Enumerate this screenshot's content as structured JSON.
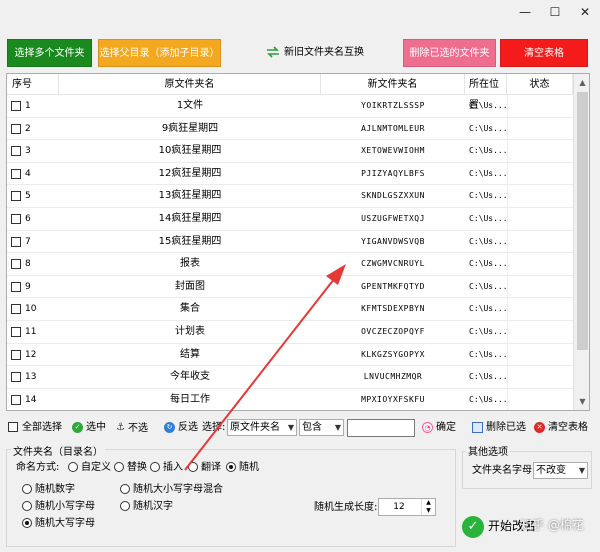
{
  "window": {
    "min": "—",
    "max": "☐",
    "close": "✕"
  },
  "toolbar": {
    "select_multi": "选择多个文件夹",
    "select_parent": "选择父目录（添加子目录）",
    "swap": "新旧文件夹名互换",
    "delete_selected": "删除已选的文件夹",
    "clear_table": "清空表格"
  },
  "colors": {
    "green": "#1a8a1e",
    "orange": "#f4a81f",
    "pink": "#ef6e8f",
    "red": "#f41b1b",
    "arrow": "#e53935"
  },
  "table": {
    "headers": [
      "序号",
      "原文件夹名",
      "新文件夹名",
      "所在位置",
      "状态"
    ],
    "rows": [
      {
        "idx": "1",
        "orig": "1文件",
        "new": "YOIKRTZLSSSP",
        "loc": "C:\\Us...",
        "status": ""
      },
      {
        "idx": "2",
        "orig": "9疯狂星期四",
        "new": "AJLNMTOMLEUR",
        "loc": "C:\\Us...",
        "status": ""
      },
      {
        "idx": "3",
        "orig": "10疯狂星期四",
        "new": "XETOWEVWIOHM",
        "loc": "C:\\Us...",
        "status": ""
      },
      {
        "idx": "4",
        "orig": "12疯狂星期四",
        "new": "PJIZYAQYLBFS",
        "loc": "C:\\Us...",
        "status": ""
      },
      {
        "idx": "5",
        "orig": "13疯狂星期四",
        "new": "SKNDLGSZXXUN",
        "loc": "C:\\Us...",
        "status": ""
      },
      {
        "idx": "6",
        "orig": "14疯狂星期四",
        "new": "USZUGFWETXQJ",
        "loc": "C:\\Us...",
        "status": ""
      },
      {
        "idx": "7",
        "orig": "15疯狂星期四",
        "new": "YIGANVDWSVQB",
        "loc": "C:\\Us...",
        "status": ""
      },
      {
        "idx": "8",
        "orig": "报表",
        "new": "CZWGMVCNRUYL",
        "loc": "C:\\Us...",
        "status": ""
      },
      {
        "idx": "9",
        "orig": "封面图",
        "new": "GPENTMKFQTYD",
        "loc": "C:\\Us...",
        "status": ""
      },
      {
        "idx": "10",
        "orig": "集合",
        "new": "KFMTSDEXPBYN",
        "loc": "C:\\Us...",
        "status": ""
      },
      {
        "idx": "11",
        "orig": "计划表",
        "new": "OVCZECZOPQYF",
        "loc": "C:\\Us...",
        "status": ""
      },
      {
        "idx": "12",
        "orig": "结算",
        "new": "KLKGZSYGOPYX",
        "loc": "C:\\Us...",
        "status": ""
      },
      {
        "idx": "13",
        "orig": "今年收支",
        "new": "LNVUCMHZMQR",
        "loc": "C:\\Us...",
        "status": ""
      },
      {
        "idx": "14",
        "orig": "每日工作",
        "new": "MPXIOYXFSKFU",
        "loc": "C:\\Us...",
        "status": ""
      }
    ]
  },
  "selection": {
    "select_all": "全部选择",
    "check": "选中",
    "uncheck": "不选",
    "invert": "反选",
    "select_label": "选择:",
    "field_value": "原文件夹名",
    "match_value": "包含",
    "search_value": "",
    "confirm": "确定",
    "delete_selected": "删除已选",
    "clear_table": "清空表格"
  },
  "naming": {
    "group_label": "文件夹名（目录名）",
    "mode_label": "命名方式:",
    "modes": [
      "自定义",
      "替换",
      "插入",
      "翻译",
      "随机"
    ],
    "selected_mode": "随机",
    "random_options": [
      "随机数字",
      "随机大小写字母混合",
      "随机小写字母",
      "随机汉字",
      "随机大写字母"
    ],
    "selected_random": "随机大写字母",
    "length_label": "随机生成长度:",
    "length_value": "12"
  },
  "other": {
    "group_label": "其他选项",
    "case_label": "文件夹名字母:",
    "case_value": "不改变"
  },
  "start": {
    "label": "开始改名",
    "watermark": "知乎 @棉花"
  }
}
